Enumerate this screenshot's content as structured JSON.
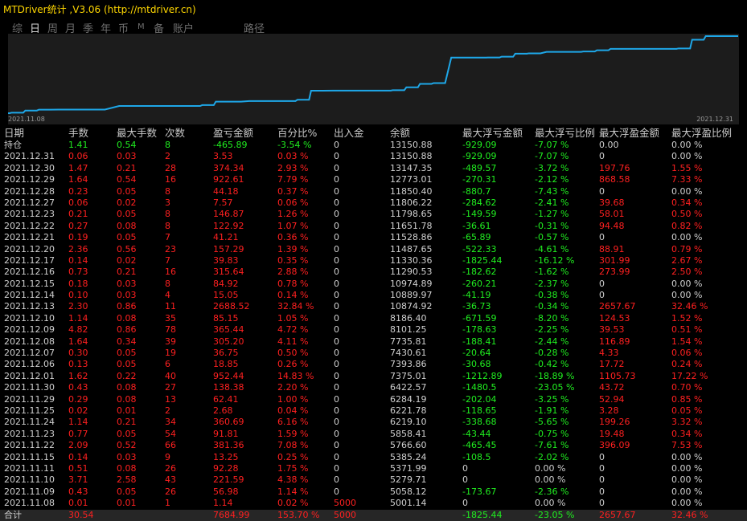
{
  "window": {
    "title": "MTDriver统计 ,V3.06 (http://mtdriver.cn)"
  },
  "tabs": [
    {
      "label": "综",
      "active": false
    },
    {
      "label": "日",
      "active": true
    },
    {
      "label": "周",
      "active": false
    },
    {
      "label": "月",
      "active": false
    },
    {
      "label": "季",
      "active": false
    },
    {
      "label": "年",
      "active": false
    },
    {
      "label": "币",
      "active": false
    },
    {
      "label": "M",
      "active": false
    },
    {
      "label": "备",
      "active": false
    },
    {
      "label": "账户",
      "active": false
    },
    {
      "label": "路径",
      "active": false
    }
  ],
  "chart_data": {
    "type": "line",
    "x_start_label": "2021.11.08",
    "x_end_label": "2021.12.31",
    "line_color": "#1ea7e8",
    "x": [
      "2021.11.08",
      "2021.11.09",
      "2021.11.10",
      "2021.11.11",
      "2021.11.15",
      "2021.11.22",
      "2021.11.23",
      "2021.11.24",
      "2021.11.25",
      "2021.11.29",
      "2021.11.30",
      "2021.12.01",
      "2021.12.06",
      "2021.12.07",
      "2021.12.08",
      "2021.12.09",
      "2021.12.10",
      "2021.12.13",
      "2021.12.14",
      "2021.12.15",
      "2021.12.16",
      "2021.12.17",
      "2021.12.20",
      "2021.12.21",
      "2021.12.22",
      "2021.12.23",
      "2021.12.27",
      "2021.12.28",
      "2021.12.29",
      "2021.12.30",
      "2021.12.31"
    ],
    "values": [
      5001.14,
      5058.12,
      5279.71,
      5371.99,
      5385.24,
      5766.6,
      5858.41,
      6219.1,
      6221.78,
      6284.19,
      6422.57,
      7375.01,
      7393.86,
      7430.61,
      7735.81,
      8101.25,
      8186.4,
      10874.92,
      10889.97,
      10974.89,
      11290.53,
      11330.36,
      11487.65,
      11528.86,
      11651.78,
      11798.65,
      11806.22,
      11850.4,
      12773.01,
      13147.35,
      13150.88
    ]
  },
  "table": {
    "headers": [
      "日期",
      "手数",
      "最大手数",
      "次数",
      "盈亏金额",
      "百分比%",
      "出入金",
      "余额",
      "最大浮亏金额",
      "最大浮亏比例",
      "最大浮盈金额",
      "最大浮盈比例"
    ],
    "position_row": [
      "持仓",
      "1.41",
      "0.54",
      "8",
      "-465.89",
      "-3.54 %",
      "0",
      "13150.88",
      "-929.09",
      "-7.07 %",
      "0.00",
      "0.00 %"
    ],
    "rows": [
      [
        "2021.12.31",
        "0.06",
        "0.03",
        "2",
        "3.53",
        "0.03 %",
        "0",
        "13150.88",
        "-929.09",
        "-7.07 %",
        "0",
        "0.00 %"
      ],
      [
        "2021.12.30",
        "1.47",
        "0.21",
        "28",
        "374.34",
        "2.93 %",
        "0",
        "13147.35",
        "-489.57",
        "-3.72 %",
        "197.76",
        "1.55 %"
      ],
      [
        "2021.12.29",
        "1.64",
        "0.54",
        "16",
        "922.61",
        "7.79 %",
        "0",
        "12773.01",
        "-270.31",
        "-2.12 %",
        "868.58",
        "7.33 %"
      ],
      [
        "2021.12.28",
        "0.23",
        "0.05",
        "8",
        "44.18",
        "0.37 %",
        "0",
        "11850.40",
        "-880.7",
        "-7.43 %",
        "0",
        "0.00 %"
      ],
      [
        "2021.12.27",
        "0.06",
        "0.02",
        "3",
        "7.57",
        "0.06 %",
        "0",
        "11806.22",
        "-284.62",
        "-2.41 %",
        "39.68",
        "0.34 %"
      ],
      [
        "2021.12.23",
        "0.21",
        "0.05",
        "8",
        "146.87",
        "1.26 %",
        "0",
        "11798.65",
        "-149.59",
        "-1.27 %",
        "58.01",
        "0.50 %"
      ],
      [
        "2021.12.22",
        "0.27",
        "0.08",
        "8",
        "122.92",
        "1.07 %",
        "0",
        "11651.78",
        "-36.61",
        "-0.31 %",
        "94.48",
        "0.82 %"
      ],
      [
        "2021.12.21",
        "0.19",
        "0.05",
        "7",
        "41.21",
        "0.36 %",
        "0",
        "11528.86",
        "-65.89",
        "-0.57 %",
        "0",
        "0.00 %"
      ],
      [
        "2021.12.20",
        "2.36",
        "0.56",
        "23",
        "157.29",
        "1.39 %",
        "0",
        "11487.65",
        "-522.33",
        "-4.61 %",
        "88.91",
        "0.79 %"
      ],
      [
        "2021.12.17",
        "0.14",
        "0.02",
        "7",
        "39.83",
        "0.35 %",
        "0",
        "11330.36",
        "-1825.44",
        "-16.12 %",
        "301.99",
        "2.67 %"
      ],
      [
        "2021.12.16",
        "0.73",
        "0.21",
        "16",
        "315.64",
        "2.88 %",
        "0",
        "11290.53",
        "-182.62",
        "-1.62 %",
        "273.99",
        "2.50 %"
      ],
      [
        "2021.12.15",
        "0.18",
        "0.03",
        "8",
        "84.92",
        "0.78 %",
        "0",
        "10974.89",
        "-260.21",
        "-2.37 %",
        "0",
        "0.00 %"
      ],
      [
        "2021.12.14",
        "0.10",
        "0.03",
        "4",
        "15.05",
        "0.14 %",
        "0",
        "10889.97",
        "-41.19",
        "-0.38 %",
        "0",
        "0.00 %"
      ],
      [
        "2021.12.13",
        "2.30",
        "0.86",
        "11",
        "2688.52",
        "32.84 %",
        "0",
        "10874.92",
        "-36.73",
        "-0.34 %",
        "2657.67",
        "32.46 %"
      ],
      [
        "2021.12.10",
        "1.14",
        "0.08",
        "35",
        "85.15",
        "1.05 %",
        "0",
        "8186.40",
        "-671.59",
        "-8.20 %",
        "124.53",
        "1.52 %"
      ],
      [
        "2021.12.09",
        "4.82",
        "0.86",
        "78",
        "365.44",
        "4.72 %",
        "0",
        "8101.25",
        "-178.63",
        "-2.25 %",
        "39.53",
        "0.51 %"
      ],
      [
        "2021.12.08",
        "1.64",
        "0.34",
        "39",
        "305.20",
        "4.11 %",
        "0",
        "7735.81",
        "-188.41",
        "-2.44 %",
        "116.89",
        "1.54 %"
      ],
      [
        "2021.12.07",
        "0.30",
        "0.05",
        "19",
        "36.75",
        "0.50 %",
        "0",
        "7430.61",
        "-20.64",
        "-0.28 %",
        "4.33",
        "0.06 %"
      ],
      [
        "2021.12.06",
        "0.13",
        "0.05",
        "6",
        "18.85",
        "0.26 %",
        "0",
        "7393.86",
        "-30.68",
        "-0.42 %",
        "17.72",
        "0.24 %"
      ],
      [
        "2021.12.01",
        "1.62",
        "0.22",
        "40",
        "952.44",
        "14.83 %",
        "0",
        "7375.01",
        "-1212.89",
        "-18.89 %",
        "1105.73",
        "17.22 %"
      ],
      [
        "2021.11.30",
        "0.43",
        "0.08",
        "27",
        "138.38",
        "2.20 %",
        "0",
        "6422.57",
        "-1480.5",
        "-23.05 %",
        "43.72",
        "0.70 %"
      ],
      [
        "2021.11.29",
        "0.29",
        "0.08",
        "13",
        "62.41",
        "1.00 %",
        "0",
        "6284.19",
        "-202.04",
        "-3.25 %",
        "52.94",
        "0.85 %"
      ],
      [
        "2021.11.25",
        "0.02",
        "0.01",
        "2",
        "2.68",
        "0.04 %",
        "0",
        "6221.78",
        "-118.65",
        "-1.91 %",
        "3.28",
        "0.05 %"
      ],
      [
        "2021.11.24",
        "1.14",
        "0.21",
        "34",
        "360.69",
        "6.16 %",
        "0",
        "6219.10",
        "-338.68",
        "-5.65 %",
        "199.26",
        "3.32 %"
      ],
      [
        "2021.11.23",
        "0.77",
        "0.05",
        "54",
        "91.81",
        "1.59 %",
        "0",
        "5858.41",
        "-43.44",
        "-0.75 %",
        "19.48",
        "0.34 %"
      ],
      [
        "2021.11.22",
        "2.09",
        "0.52",
        "66",
        "381.36",
        "7.08 %",
        "0",
        "5766.60",
        "-465.45",
        "-7.61 %",
        "396.09",
        "7.53 %"
      ],
      [
        "2021.11.15",
        "0.14",
        "0.03",
        "9",
        "13.25",
        "0.25 %",
        "0",
        "5385.24",
        "-108.5",
        "-2.02 %",
        "0",
        "0.00 %"
      ],
      [
        "2021.11.11",
        "0.51",
        "0.08",
        "26",
        "92.28",
        "1.75 %",
        "0",
        "5371.99",
        "0",
        "0.00 %",
        "0",
        "0.00 %"
      ],
      [
        "2021.11.10",
        "3.71",
        "2.58",
        "43",
        "221.59",
        "4.38 %",
        "0",
        "5279.71",
        "0",
        "0.00 %",
        "0",
        "0.00 %"
      ],
      [
        "2021.11.09",
        "0.43",
        "0.05",
        "26",
        "56.98",
        "1.14 %",
        "0",
        "5058.12",
        "-173.67",
        "-2.36 %",
        "0",
        "0.00 %"
      ],
      [
        "2021.11.08",
        "0.01",
        "0.01",
        "1",
        "1.14",
        "0.02 %",
        "5000",
        "5001.14",
        "0",
        "0.00 %",
        "0",
        "0.00 %"
      ]
    ],
    "total_row": [
      "合计",
      "30.54",
      "",
      "",
      "7684.99",
      "153.70 %",
      "5000",
      "",
      "-1825.44",
      "-23.05 %",
      "2657.67",
      "32.46 %"
    ]
  }
}
